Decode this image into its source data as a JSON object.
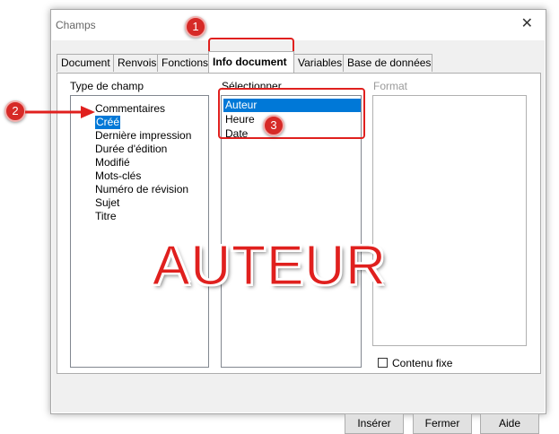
{
  "dialog": {
    "title": "Champs"
  },
  "tabs": [
    {
      "label": "Document"
    },
    {
      "label": "Renvois"
    },
    {
      "label": "Fonctions"
    },
    {
      "label": "Info document"
    },
    {
      "label": "Variables"
    },
    {
      "label": "Base de données"
    }
  ],
  "type_champ": {
    "label": "Type de champ",
    "items": [
      "Commentaires",
      "Créé",
      "Dernière impression",
      "Durée d'édition",
      "Modifié",
      "Mots-clés",
      "Numéro de révision",
      "Sujet",
      "Titre"
    ],
    "selected": "Créé"
  },
  "selectionner": {
    "label": "Sélectionner",
    "items": [
      "Auteur",
      "Heure",
      "Date"
    ],
    "selected": "Auteur"
  },
  "format": {
    "label": "Format"
  },
  "contenu_fixe": {
    "label": "Contenu fixe",
    "checked": false
  },
  "buttons": {
    "inserer": "Insérer",
    "fermer": "Fermer",
    "aide": "Aide"
  },
  "annotations": {
    "badge1": "1",
    "badge2": "2",
    "badge3": "3",
    "overlay_text": "AUTEUR",
    "color": "#e0201e"
  }
}
